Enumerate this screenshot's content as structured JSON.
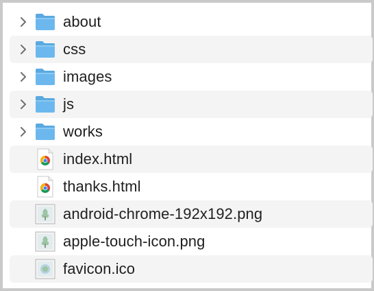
{
  "items": [
    {
      "name": "about",
      "kind": "folder",
      "expandable": true,
      "icon": "folder-icon"
    },
    {
      "name": "css",
      "kind": "folder",
      "expandable": true,
      "icon": "folder-icon"
    },
    {
      "name": "images",
      "kind": "folder",
      "expandable": true,
      "icon": "folder-icon"
    },
    {
      "name": "js",
      "kind": "folder",
      "expandable": true,
      "icon": "folder-icon"
    },
    {
      "name": "works",
      "kind": "folder",
      "expandable": true,
      "icon": "folder-icon"
    },
    {
      "name": "index.html",
      "kind": "html",
      "expandable": false,
      "icon": "chrome-document-icon"
    },
    {
      "name": "thanks.html",
      "kind": "html",
      "expandable": false,
      "icon": "chrome-document-icon"
    },
    {
      "name": "android-chrome-192x192.png",
      "kind": "image",
      "expandable": false,
      "icon": "image-file-icon"
    },
    {
      "name": "apple-touch-icon.png",
      "kind": "image",
      "expandable": false,
      "icon": "image-file-icon"
    },
    {
      "name": "favicon.ico",
      "kind": "image",
      "expandable": false,
      "icon": "image-file-icon"
    }
  ],
  "colors": {
    "folder": "#6cb8ee",
    "folder_tab": "#5aa9e0",
    "row_alt": "#f4f4f4",
    "text": "#1f1f1f"
  }
}
